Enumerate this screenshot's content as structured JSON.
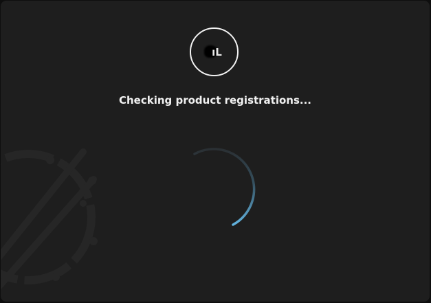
{
  "logo": {
    "text": "ıL",
    "icon": "brand-logo-circle-icon"
  },
  "status": {
    "message": "Checking product registrations..."
  },
  "spinner": {
    "icon": "loading-spinner-icon",
    "color_start": "#2a2f33",
    "color_end": "#62b3df"
  },
  "background": {
    "icon": "drum-sticks-watermark-icon",
    "window_color": "#1e1e1e"
  }
}
